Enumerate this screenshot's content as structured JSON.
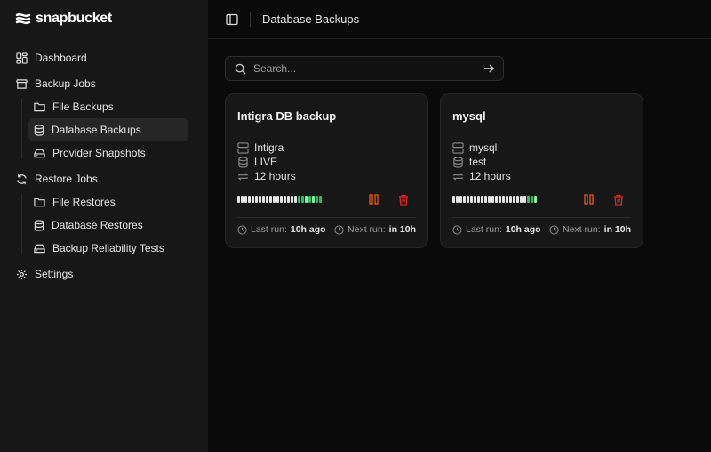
{
  "app": {
    "name": "snapbucket"
  },
  "sidebar": {
    "items": [
      {
        "label": "Dashboard",
        "icon": "grid-icon"
      },
      {
        "label": "Backup Jobs",
        "icon": "archive-icon",
        "children": [
          {
            "label": "File Backups",
            "icon": "folder-icon"
          },
          {
            "label": "Database Backups",
            "icon": "database-icon",
            "active": true
          },
          {
            "label": "Provider Snapshots",
            "icon": "hard-drive-icon"
          }
        ]
      },
      {
        "label": "Restore Jobs",
        "icon": "refresh-icon",
        "children": [
          {
            "label": "File Restores",
            "icon": "folder-icon"
          },
          {
            "label": "Database Restores",
            "icon": "database-icon"
          },
          {
            "label": "Backup Reliability Tests",
            "icon": "hard-drive-icon"
          }
        ]
      },
      {
        "label": "Settings",
        "icon": "gear-icon"
      }
    ]
  },
  "header": {
    "title": "Database Backups"
  },
  "search": {
    "placeholder": "Search...",
    "value": ""
  },
  "colors": {
    "success": "#22c55e",
    "pause": "#ea580c",
    "delete": "#dc2626",
    "neutral": "#e5e5e5"
  },
  "cards": [
    {
      "title": "Intigra DB backup",
      "server": "Intigra",
      "database": "LIVE",
      "schedule": "12 hours",
      "history": [
        "n",
        "n",
        "n",
        "n",
        "n",
        "n",
        "n",
        "n",
        "n",
        "n",
        "n",
        "n",
        "n",
        "n",
        "n",
        "n",
        "n",
        "s",
        "s",
        "l",
        "s",
        "l",
        "s",
        "s"
      ],
      "last_run_label": "Last run:",
      "last_run": "10h ago",
      "next_run_label": "Next run:",
      "next_run": "in 10h"
    },
    {
      "title": "mysql",
      "server": "mysql",
      "database": "test",
      "schedule": "12 hours",
      "history": [
        "n",
        "n",
        "n",
        "n",
        "n",
        "n",
        "n",
        "n",
        "n",
        "n",
        "n",
        "n",
        "n",
        "n",
        "n",
        "n",
        "n",
        "n",
        "n",
        "n",
        "n",
        "s",
        "s",
        "l"
      ],
      "last_run_label": "Last run:",
      "last_run": "10h ago",
      "next_run_label": "Next run:",
      "next_run": "in 10h"
    }
  ]
}
